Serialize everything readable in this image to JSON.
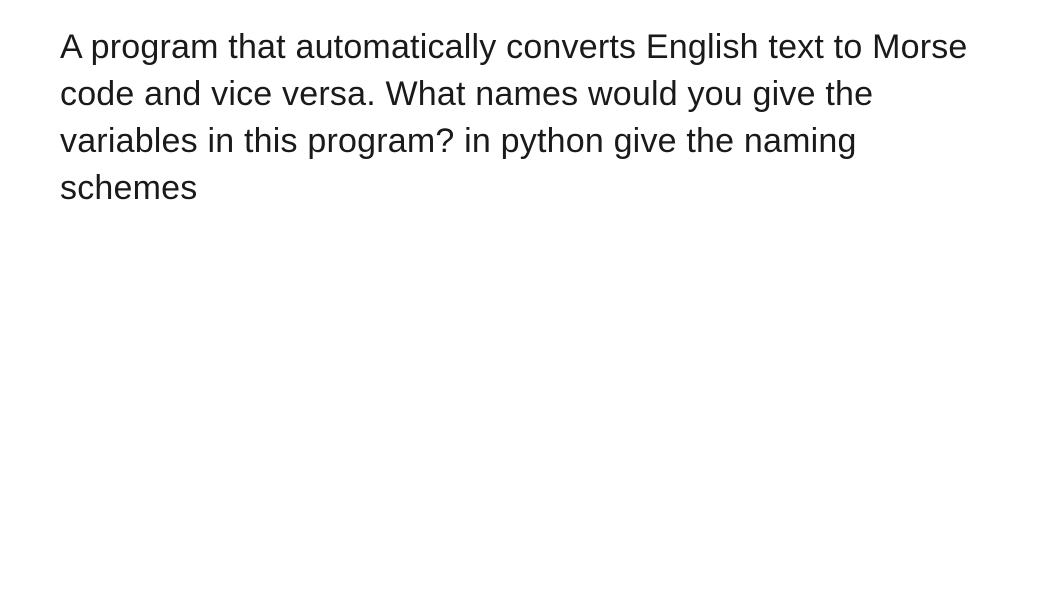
{
  "content": {
    "paragraph": "A program that automatically converts English text to Morse code and vice versa. What names would you give the variables in this program? in python give the naming schemes"
  }
}
